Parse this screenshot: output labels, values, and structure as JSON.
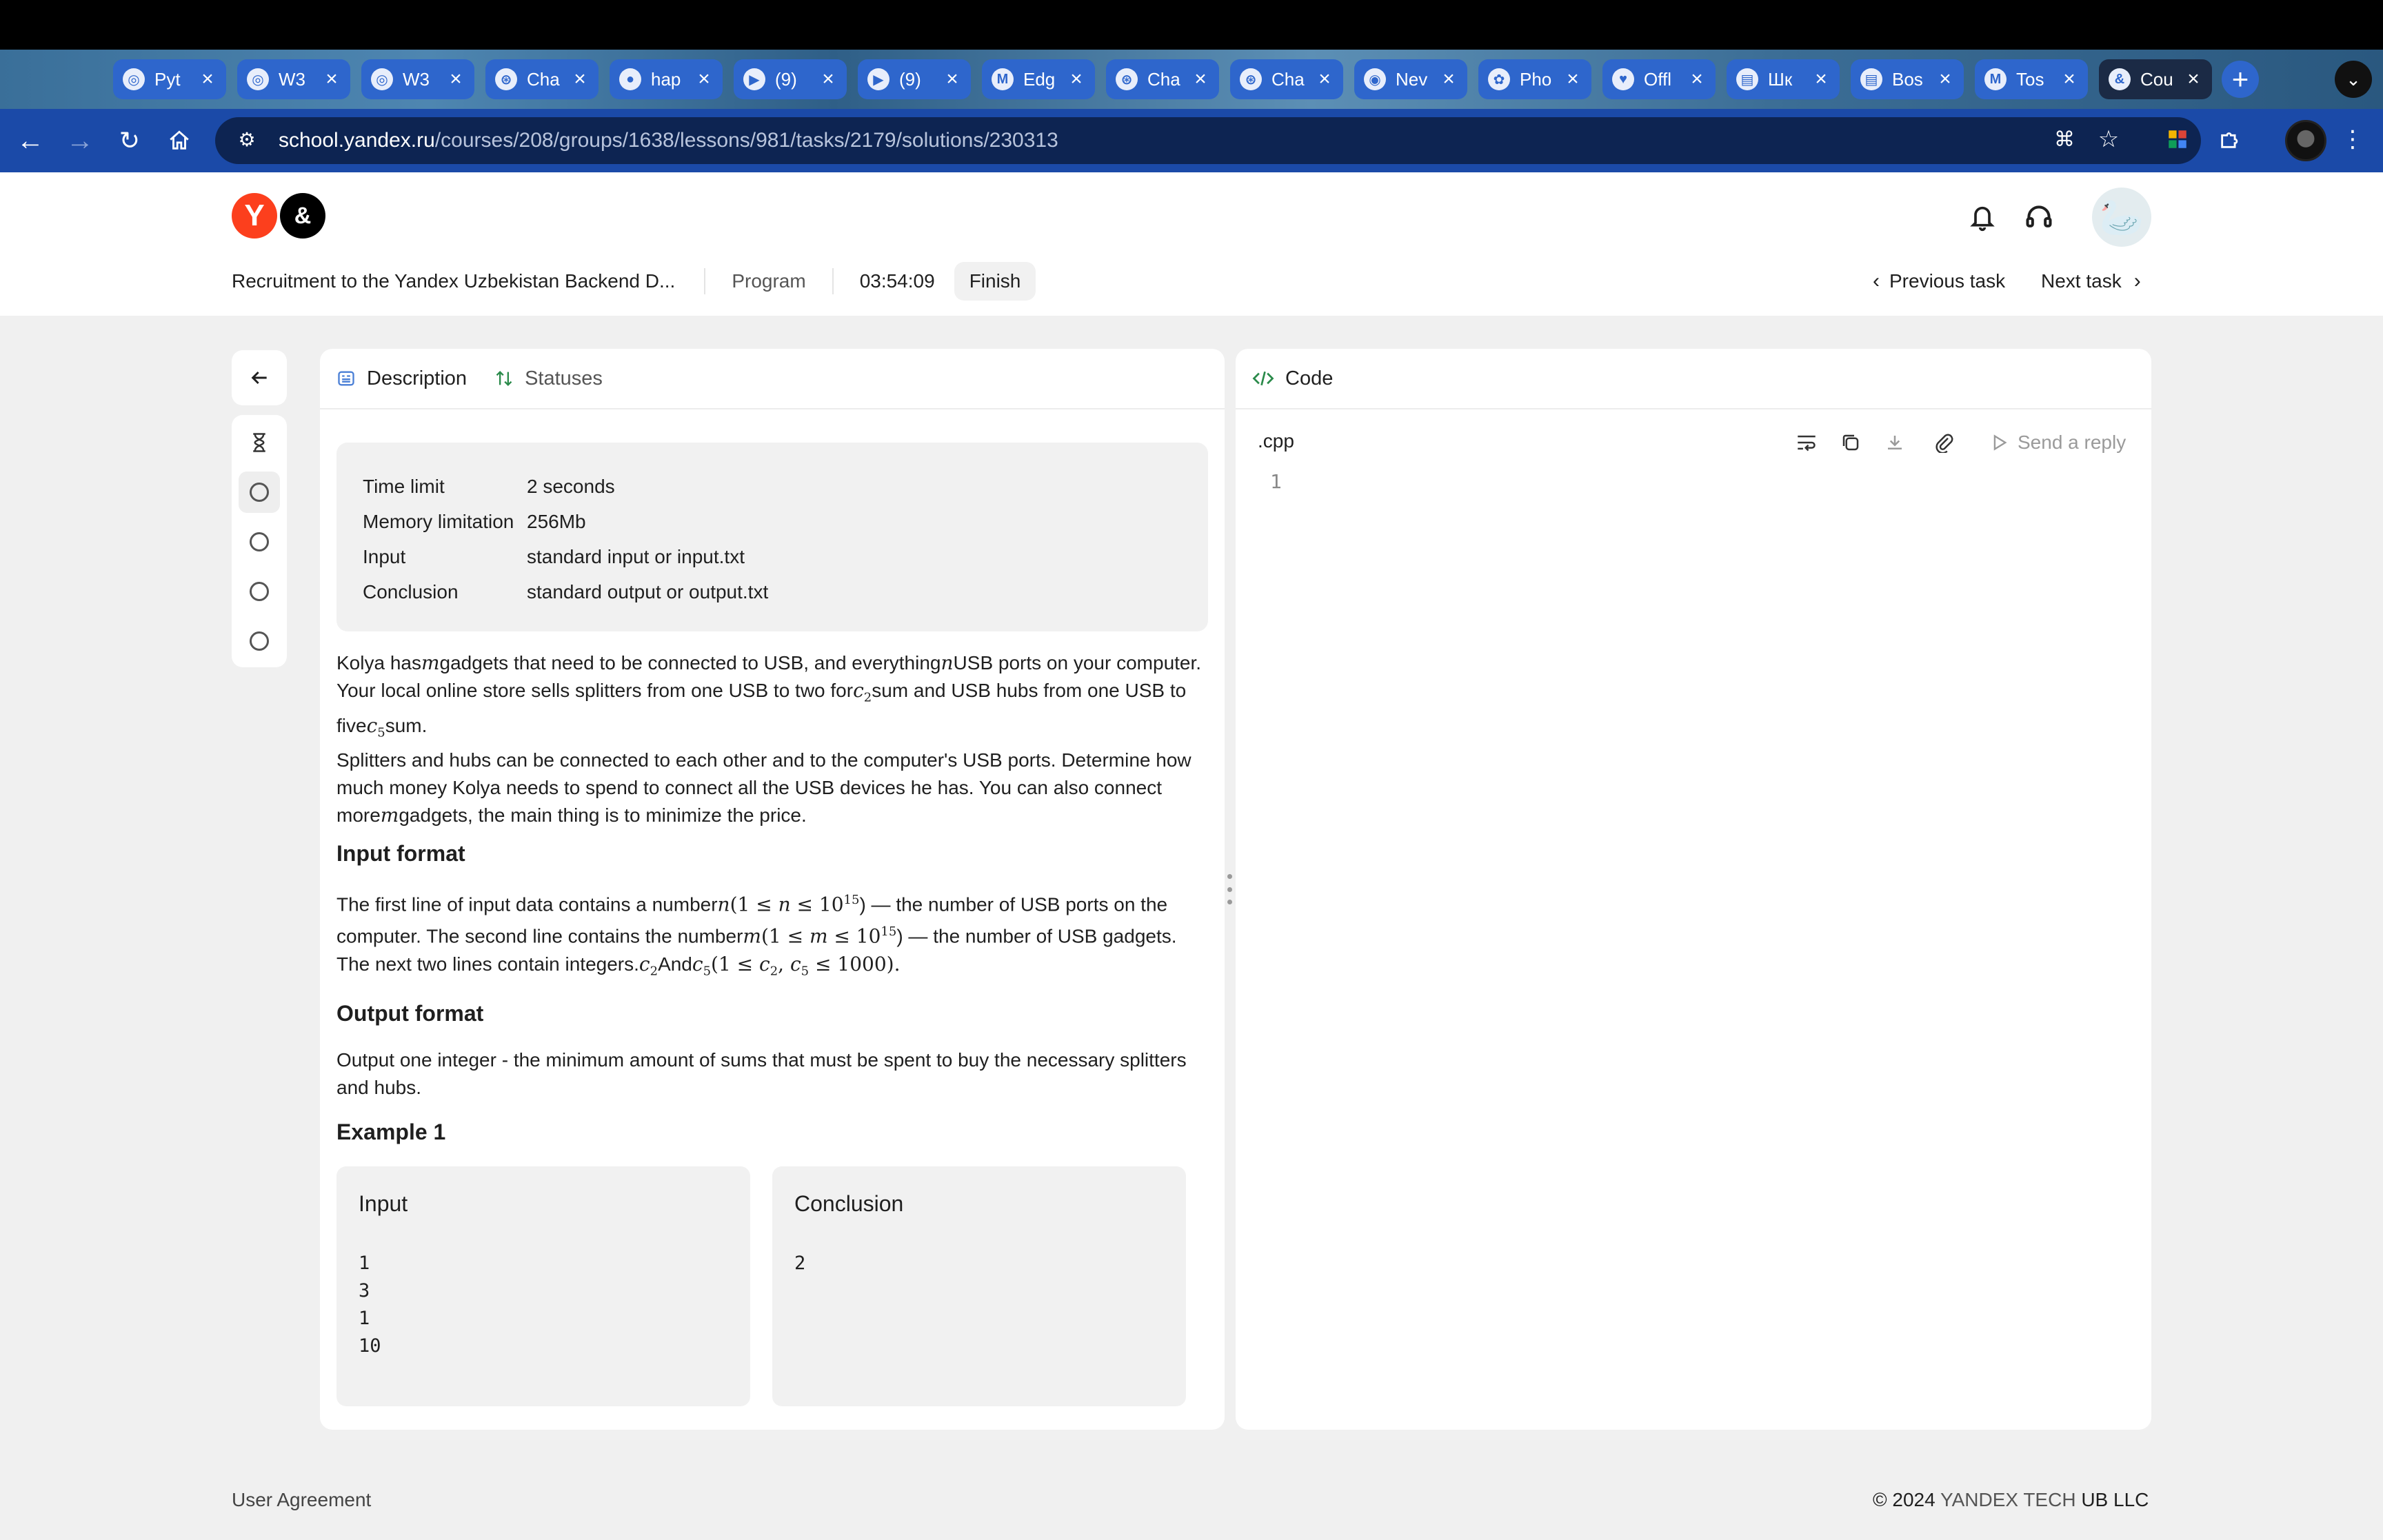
{
  "browser": {
    "tabs": [
      {
        "title": "Pyt",
        "icon": "openai-icon"
      },
      {
        "title": "W3",
        "icon": "openai-icon"
      },
      {
        "title": "W3",
        "icon": "openai-icon"
      },
      {
        "title": "Cha",
        "icon": "chatgpt-icon"
      },
      {
        "title": "hap",
        "icon": "github-icon"
      },
      {
        "title": "(9)",
        "icon": "youtube-icon"
      },
      {
        "title": "(9)",
        "icon": "youtube-icon"
      },
      {
        "title": "Edg",
        "icon": "gmail-icon"
      },
      {
        "title": "Cha",
        "icon": "chatgpt-icon"
      },
      {
        "title": "Cha",
        "icon": "chatgpt-icon"
      },
      {
        "title": "Nev",
        "icon": "chrome-icon"
      },
      {
        "title": "Pho",
        "icon": "photos-icon"
      },
      {
        "title": "Offl",
        "icon": "heart-icon"
      },
      {
        "title": "Шк",
        "icon": "doc-icon"
      },
      {
        "title": "Bos",
        "icon": "doc-icon"
      },
      {
        "title": "Tos",
        "icon": "gmail-icon"
      },
      {
        "title": "Cou",
        "icon": "yandex-icon",
        "active": true
      }
    ],
    "url_host": "school.yandex.ru",
    "url_path": "/courses/208/groups/1638/lessons/981/tasks/2179/solutions/230313"
  },
  "header": {
    "logo_y": "Y",
    "logo_and": "&",
    "course_title": "Recruitment to the Yandex Uzbekistan Backend D...",
    "program": "Program",
    "timer": "03:54:09",
    "finish": "Finish",
    "prev_task": "Previous task",
    "next_task": "Next task",
    "avatar_emoji": "🦢"
  },
  "description": {
    "tab_description": "Description",
    "tab_statuses": "Statuses",
    "limits": [
      {
        "key": "Time limit",
        "value": "2 seconds"
      },
      {
        "key": "Memory limitation",
        "value": "256Mb"
      },
      {
        "key": "Input",
        "value": "standard input or input.txt"
      },
      {
        "key": "Conclusion",
        "value": "standard output or output.txt"
      }
    ],
    "statement": {
      "p1": "Kolya has",
      "m": "m",
      "p2": "gadgets that need to be connected to USB, and everything",
      "n": "n",
      "p3": "USB ports on your computer. Your local online store sells splitters from one USB to two for",
      "c2": "c",
      "c2_sub": "2",
      "p4": "sum and USB hubs from one USB to five",
      "c5": "c",
      "c5_sub": "5",
      "p5": "sum.",
      "p6": "Splitters and hubs can be connected to each other and to the computer's USB ports. Determine how much money Kolya needs to spend to connect all the USB devices he has. You can also connect more",
      "p7": "gadgets, the main thing is to minimize the price."
    },
    "input_format_title": "Input format",
    "input_format": {
      "a1": "The first line of input data contains a number",
      "a2": "(1 ≤ ",
      "a3": " ≤ 10",
      "exp": "15",
      "a4": ") — the number of USB ports on the computer. The second line contains the number",
      "a5": ") — the number of USB gadgets. The next two lines contain integers.",
      "a6": "And",
      "a7": "(1 ≤ ",
      "a8": ", ",
      "a9": " ≤ 1000)."
    },
    "output_format_title": "Output format",
    "output_format": "Output one integer - the minimum amount of sums that must be spent to buy the necessary splitters and hubs.",
    "example_title": "Example 1",
    "example_input_label": "Input",
    "example_input_lines": [
      "1",
      "3",
      "1",
      "10"
    ],
    "example_output_label": "Conclusion",
    "example_output_lines": [
      "2"
    ]
  },
  "code": {
    "title": "Code",
    "language": ".cpp",
    "send": "Send a reply",
    "line_numbers": [
      "1"
    ]
  },
  "footer": {
    "agreement": "User Agreement",
    "copyright_prefix": "© 2024",
    "copyright_brand": "YANDEX TECH",
    "copyright_suffix": "UB LLC"
  },
  "colors": {
    "tab_bg": "#2e66cc",
    "nav_bg": "#1b4aa8",
    "omnibox_bg": "#0d2452",
    "yandex_red": "#fc3f1d",
    "code_accent": "#2a8a4a",
    "desc_accent": "#4a7fd6"
  }
}
